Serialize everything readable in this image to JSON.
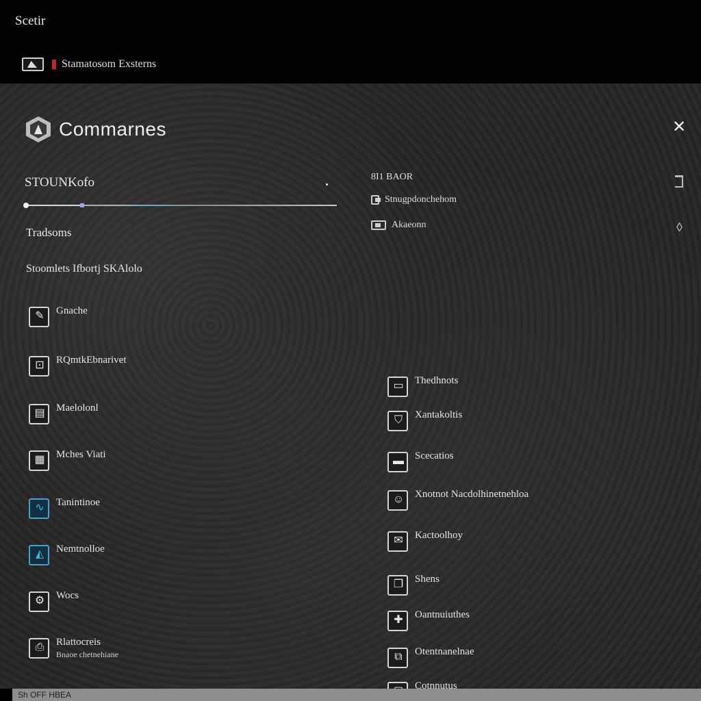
{
  "window": {
    "title": "Scetir"
  },
  "tab": {
    "label": "Stamatosom Exsterns"
  },
  "dialog": {
    "title": "Commarnes",
    "close_icon": "close-icon",
    "header_icon": "hex-app-icon"
  },
  "left": {
    "section_label": "STOUNKofo",
    "slider_percent": 18,
    "group_label": "Tradsoms",
    "subgroup_label": "Stoomlets Ifbortj SKAlolo",
    "items": [
      {
        "icon": "pen-icon",
        "glyph": "✎",
        "blue": false,
        "label": "Gnache",
        "sub": ""
      },
      {
        "icon": "lock-icon",
        "glyph": "⊡",
        "blue": false,
        "label": "RQmtkEbnarivet",
        "sub": ""
      },
      {
        "icon": "document-icon",
        "glyph": "▤",
        "blue": false,
        "label": "Maelolonl",
        "sub": ""
      },
      {
        "icon": "grid-icon",
        "glyph": "▦",
        "blue": false,
        "label": "Mches Viati",
        "sub": ""
      },
      {
        "icon": "wave-icon",
        "glyph": "∿",
        "blue": true,
        "label": "Tanintinoe",
        "sub": ""
      },
      {
        "icon": "chart-icon",
        "glyph": "◭",
        "blue": true,
        "label": "Nemtnolloe",
        "sub": ""
      },
      {
        "icon": "gear-icon",
        "glyph": "⚙",
        "blue": false,
        "label": "Wocs",
        "sub": ""
      },
      {
        "icon": "printer-icon",
        "glyph": "⎙",
        "blue": false,
        "label": "Rlattocreis",
        "sub": "Bnaoe chetnehiane"
      }
    ]
  },
  "right": {
    "header": "8I1 BAOR",
    "rows": [
      {
        "icon": "small-square-icon",
        "label": "Stnugpdonchehom"
      },
      {
        "icon": "window-icon",
        "label": "Akaeonn"
      }
    ],
    "items": [
      {
        "icon": "window-icon",
        "glyph": "▭",
        "blue": false,
        "label": "Thedhnots"
      },
      {
        "icon": "shield-icon",
        "glyph": "⛉",
        "blue": false,
        "label": "Xantakoltis"
      },
      {
        "icon": "display-icon",
        "glyph": "▬",
        "blue": false,
        "label": "Scecatios"
      },
      {
        "icon": "user-icon",
        "glyph": "☺",
        "blue": false,
        "label": "Xnotnot Nacdolhinetnehloa"
      },
      {
        "icon": "chat-icon",
        "glyph": "✉",
        "blue": false,
        "label": "Kactoolhoy"
      },
      {
        "icon": "folder-icon",
        "glyph": "❐",
        "blue": false,
        "label": "Shens"
      },
      {
        "icon": "puzzle-icon",
        "glyph": "✚",
        "blue": false,
        "label": "Oantnuiuthes"
      },
      {
        "icon": "tag-icon",
        "glyph": "⧉",
        "blue": false,
        "label": "Otentnanelnae"
      },
      {
        "icon": "box-icon",
        "glyph": "▢",
        "blue": false,
        "label": "Cotnnutus"
      }
    ]
  },
  "bottom": {
    "text": "Sh OFF HBEA"
  }
}
